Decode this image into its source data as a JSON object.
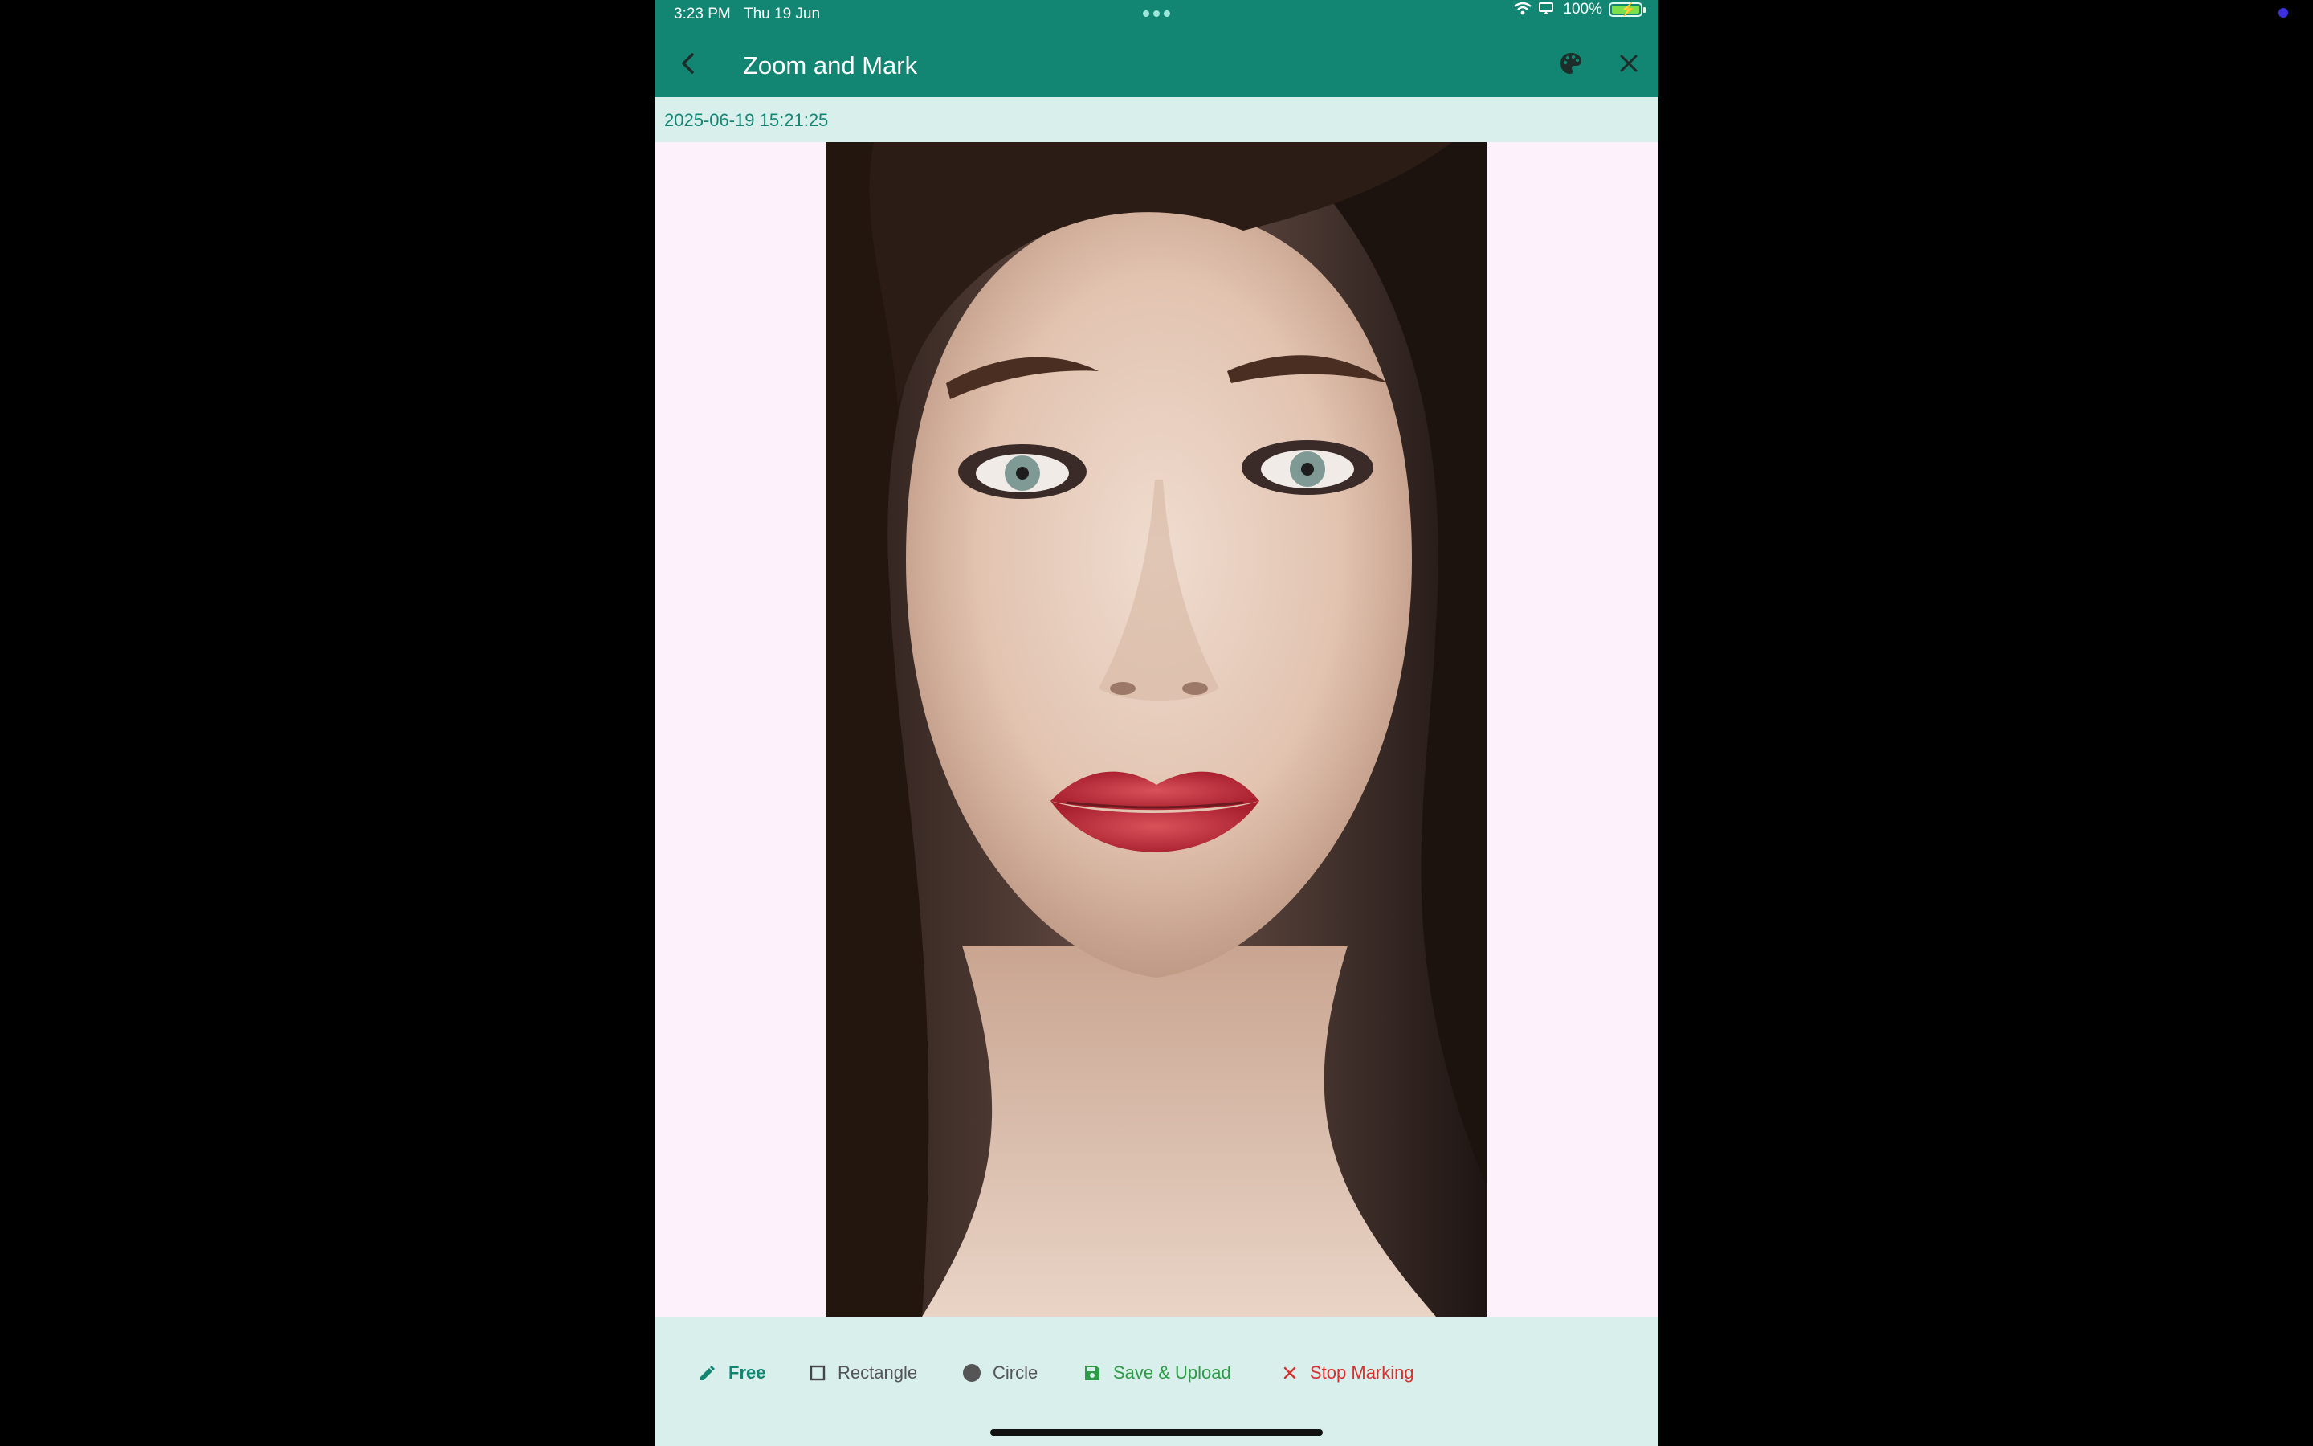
{
  "status_bar": {
    "time": "3:23 PM",
    "date": "Thu 19 Jun",
    "battery": "100%"
  },
  "app_bar": {
    "title": "Zoom and Mark",
    "back_icon": "chevron-left-icon",
    "palette_icon": "palette-icon",
    "close_icon": "close-icon",
    "color": "#138673"
  },
  "timestamp": "2025-06-19 15:21:25",
  "image": {
    "subject": "portrait photo"
  },
  "toolbar": {
    "free_label": "Free",
    "rectangle_label": "Rectangle",
    "circle_label": "Circle",
    "save_label": "Save & Upload",
    "stop_label": "Stop Marking",
    "active_tool": "Free"
  },
  "colors": {
    "accent": "#138673",
    "save": "#2e9b46",
    "stop": "#d8302e",
    "panel": "#d8efec",
    "canvas": "#fdf1fb"
  }
}
